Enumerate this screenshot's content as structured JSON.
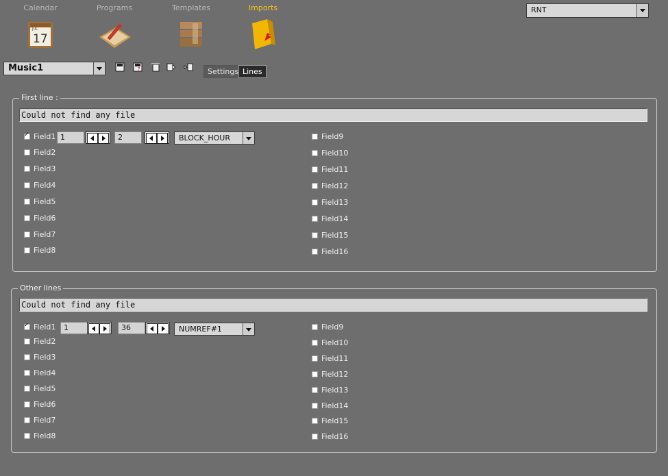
{
  "nav": [
    {
      "label": "Calendar",
      "icon": "calendar-icon",
      "day": "17",
      "month": "JUL"
    },
    {
      "label": "Programs",
      "icon": "pencil-notepad-icon"
    },
    {
      "label": "Templates",
      "icon": "stacked-boxes-icon"
    },
    {
      "label": "Imports",
      "icon": "import-arrow-icon",
      "active": true
    }
  ],
  "station_select": {
    "value": "RNT"
  },
  "profile_select": {
    "value": "Music1"
  },
  "toolbar": {
    "icons": [
      "save-icon",
      "save-as-icon",
      "delete-icon",
      "export-icon",
      "import-icon"
    ]
  },
  "tabs": [
    {
      "label": "Settings",
      "active": false
    },
    {
      "label": "Lines",
      "active": true
    }
  ],
  "first_line": {
    "title": "First line :",
    "file_text": "Could not find any file",
    "field1": {
      "label": "Field1",
      "checked": true,
      "start": "1",
      "length": "2",
      "type": "BLOCK_HOUR"
    },
    "left_fields": [
      "Field2",
      "Field3",
      "Field4",
      "Field5",
      "Field6",
      "Field7",
      "Field8"
    ],
    "right_fields": [
      "Field9",
      "Field10",
      "Field11",
      "Field12",
      "Field13",
      "Field14",
      "Field15",
      "Field16"
    ]
  },
  "other_lines": {
    "title": "Other lines",
    "file_text": "Could not find any file",
    "field1": {
      "label": "Field1",
      "checked": true,
      "start": "1",
      "length": "36",
      "type": "NUMREF#1"
    },
    "left_fields": [
      "Field2",
      "Field3",
      "Field4",
      "Field5",
      "Field6",
      "Field7",
      "Field8"
    ],
    "right_fields": [
      "Field9",
      "Field10",
      "Field11",
      "Field12",
      "Field13",
      "Field14",
      "Field15",
      "Field16"
    ]
  },
  "colors": {
    "active_nav": "#f5c518",
    "background": "#6e6e6e"
  }
}
